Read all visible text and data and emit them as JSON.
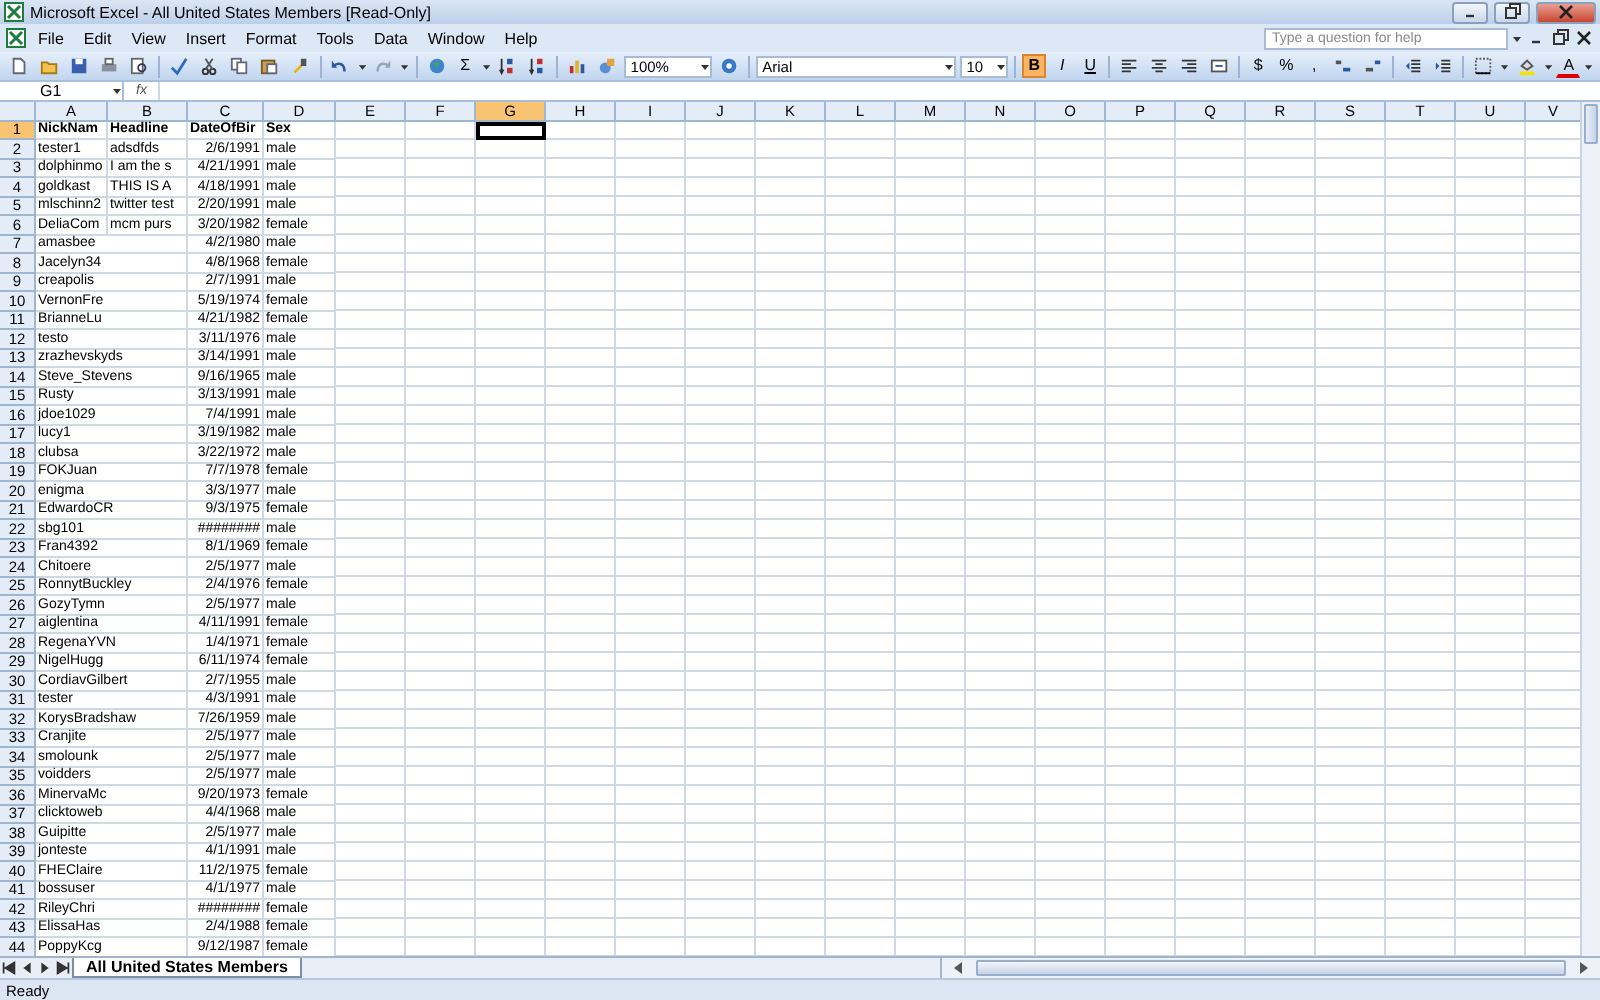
{
  "window": {
    "title": "Microsoft Excel - All United States Members  [Read-Only]"
  },
  "menu": [
    "File",
    "Edit",
    "View",
    "Insert",
    "Format",
    "Tools",
    "Data",
    "Window",
    "Help"
  ],
  "help_box": {
    "placeholder": "Type a question for help"
  },
  "toolbar": {
    "sum": "Σ",
    "zoom": "100%",
    "font": "Arial",
    "size": "10",
    "styles": [
      {
        "label": "B",
        "kind": "bold",
        "selected": true
      },
      {
        "label": "I",
        "kind": "italic",
        "selected": false
      },
      {
        "label": "U",
        "kind": "underline",
        "selected": false
      }
    ],
    "number_formats": [
      "$",
      "%",
      ","
    ],
    "font_color": "A"
  },
  "formula_bar": {
    "name_box": "G1",
    "function_label": "fx"
  },
  "columns": [
    {
      "label": "A",
      "selected": false
    },
    {
      "label": "B",
      "selected": false
    },
    {
      "label": "C",
      "selected": false
    },
    {
      "label": "D",
      "selected": false
    },
    {
      "label": "E",
      "selected": false
    },
    {
      "label": "F",
      "selected": false
    },
    {
      "label": "G",
      "selected": true
    },
    {
      "label": "H",
      "selected": false
    },
    {
      "label": "I",
      "selected": false
    },
    {
      "label": "J",
      "selected": false
    },
    {
      "label": "K",
      "selected": false
    },
    {
      "label": "L",
      "selected": false
    },
    {
      "label": "M",
      "selected": false
    },
    {
      "label": "N",
      "selected": false
    },
    {
      "label": "O",
      "selected": false
    },
    {
      "label": "P",
      "selected": false
    },
    {
      "label": "Q",
      "selected": false
    },
    {
      "label": "R",
      "selected": false
    },
    {
      "label": "S",
      "selected": false
    },
    {
      "label": "T",
      "selected": false
    },
    {
      "label": "U",
      "selected": false
    },
    {
      "label": "V",
      "selected": false
    }
  ],
  "header_row": {
    "label": "1",
    "selected": true,
    "A": "NickNam",
    "B": "Headline",
    "C": "DateOfBir",
    "D": "Sex"
  },
  "rows": [
    {
      "label": "2",
      "selected": false,
      "A": "tester1",
      "B": "adsdfds",
      "C": "2/6/1991",
      "D": "male"
    },
    {
      "label": "3",
      "selected": false,
      "A": "dolphinmo",
      "B": "I am the s",
      "C": "4/21/1991",
      "D": "male"
    },
    {
      "label": "4",
      "selected": false,
      "A": "goldkast",
      "B": "THIS IS A",
      "C": "4/18/1991",
      "D": "male"
    },
    {
      "label": "5",
      "selected": false,
      "A": "mlschinn2",
      "B": "twitter test",
      "C": "2/20/1991",
      "D": "male"
    },
    {
      "label": "6",
      "selected": false,
      "A": "DeliaCom",
      "B": "mcm purs",
      "C": "3/20/1982",
      "D": "female"
    },
    {
      "label": "7",
      "selected": false,
      "A": "amasbee",
      "C": "4/2/1980",
      "D": "male"
    },
    {
      "label": "8",
      "selected": false,
      "A": "Jacelyn34",
      "C": "4/8/1968",
      "D": "female"
    },
    {
      "label": "9",
      "selected": false,
      "A": "creapolis",
      "C": "2/7/1991",
      "D": "male"
    },
    {
      "label": "10",
      "selected": false,
      "A": "VernonFre",
      "C": "5/19/1974",
      "D": "female"
    },
    {
      "label": "11",
      "selected": false,
      "A": "BrianneLu",
      "C": "4/21/1982",
      "D": "female"
    },
    {
      "label": "12",
      "selected": false,
      "A": "testo",
      "C": "3/11/1976",
      "D": "male"
    },
    {
      "label": "13",
      "selected": false,
      "A": "zrazhevskyds",
      "C": "3/14/1991",
      "D": "male"
    },
    {
      "label": "14",
      "selected": false,
      "A": "Steve_Stevens",
      "C": "9/16/1965",
      "D": "male"
    },
    {
      "label": "15",
      "selected": false,
      "A": "Rusty",
      "C": "3/13/1991",
      "D": "male"
    },
    {
      "label": "16",
      "selected": false,
      "A": "jdoe1029",
      "C": "7/4/1991",
      "D": "male"
    },
    {
      "label": "17",
      "selected": false,
      "A": "lucy1",
      "C": "3/19/1982",
      "D": "male"
    },
    {
      "label": "18",
      "selected": false,
      "A": "clubsa",
      "C": "3/22/1972",
      "D": "male"
    },
    {
      "label": "19",
      "selected": false,
      "A": "FOKJuan",
      "C": "7/7/1978",
      "D": "female"
    },
    {
      "label": "20",
      "selected": false,
      "A": "enigma",
      "C": "3/3/1977",
      "D": "male"
    },
    {
      "label": "21",
      "selected": false,
      "A": "EdwardoCR",
      "C": "9/3/1975",
      "D": "female"
    },
    {
      "label": "22",
      "selected": false,
      "A": "sbg101",
      "C": "########",
      "D": "male"
    },
    {
      "label": "23",
      "selected": false,
      "A": "Fran4392",
      "C": "8/1/1969",
      "D": "female"
    },
    {
      "label": "24",
      "selected": false,
      "A": "Chitoere",
      "C": "2/5/1977",
      "D": "male"
    },
    {
      "label": "25",
      "selected": false,
      "A": "RonnytBuckley",
      "C": "2/4/1976",
      "D": "female"
    },
    {
      "label": "26",
      "selected": false,
      "A": "GozyTymn",
      "C": "2/5/1977",
      "D": "male"
    },
    {
      "label": "27",
      "selected": false,
      "A": "aiglentina",
      "C": "4/11/1991",
      "D": "female"
    },
    {
      "label": "28",
      "selected": false,
      "A": "RegenaYVN",
      "C": "1/4/1971",
      "D": "female"
    },
    {
      "label": "29",
      "selected": false,
      "A": "NigelHugg",
      "C": "6/11/1974",
      "D": "female"
    },
    {
      "label": "30",
      "selected": false,
      "A": "CordiavGilbert",
      "C": "2/7/1955",
      "D": "male"
    },
    {
      "label": "31",
      "selected": false,
      "A": "tester",
      "C": "4/3/1991",
      "D": "male"
    },
    {
      "label": "32",
      "selected": false,
      "A": "KorysBradshaw",
      "C": "7/26/1959",
      "D": "male"
    },
    {
      "label": "33",
      "selected": false,
      "A": "Cranjite",
      "C": "2/5/1977",
      "D": "male"
    },
    {
      "label": "34",
      "selected": false,
      "A": "smolounk",
      "C": "2/5/1977",
      "D": "male"
    },
    {
      "label": "35",
      "selected": false,
      "A": "voidders",
      "C": "2/5/1977",
      "D": "male"
    },
    {
      "label": "36",
      "selected": false,
      "A": "MinervaMc",
      "C": "9/20/1973",
      "D": "female"
    },
    {
      "label": "37",
      "selected": false,
      "A": "clicktoweb",
      "C": "4/4/1968",
      "D": "male"
    },
    {
      "label": "38",
      "selected": false,
      "A": "Guipitte",
      "C": "2/5/1977",
      "D": "male"
    },
    {
      "label": "39",
      "selected": false,
      "A": "jonteste",
      "C": "4/1/1991",
      "D": "male"
    },
    {
      "label": "40",
      "selected": false,
      "A": "FHEClaire",
      "C": "11/2/1975",
      "D": "female"
    },
    {
      "label": "41",
      "selected": false,
      "A": "bossuser",
      "C": "4/1/1977",
      "D": "male"
    },
    {
      "label": "42",
      "selected": false,
      "A": "RileyChri",
      "C": "########",
      "D": "female"
    },
    {
      "label": "43",
      "selected": false,
      "A": "ElissaHas",
      "C": "2/4/1988",
      "D": "female"
    },
    {
      "label": "44",
      "selected": false,
      "A": "PoppyKcg",
      "C": "9/12/1987",
      "D": "female"
    }
  ],
  "sheet_tabs": [
    {
      "label": "All United States Members",
      "selected": true
    }
  ],
  "status": "Ready"
}
